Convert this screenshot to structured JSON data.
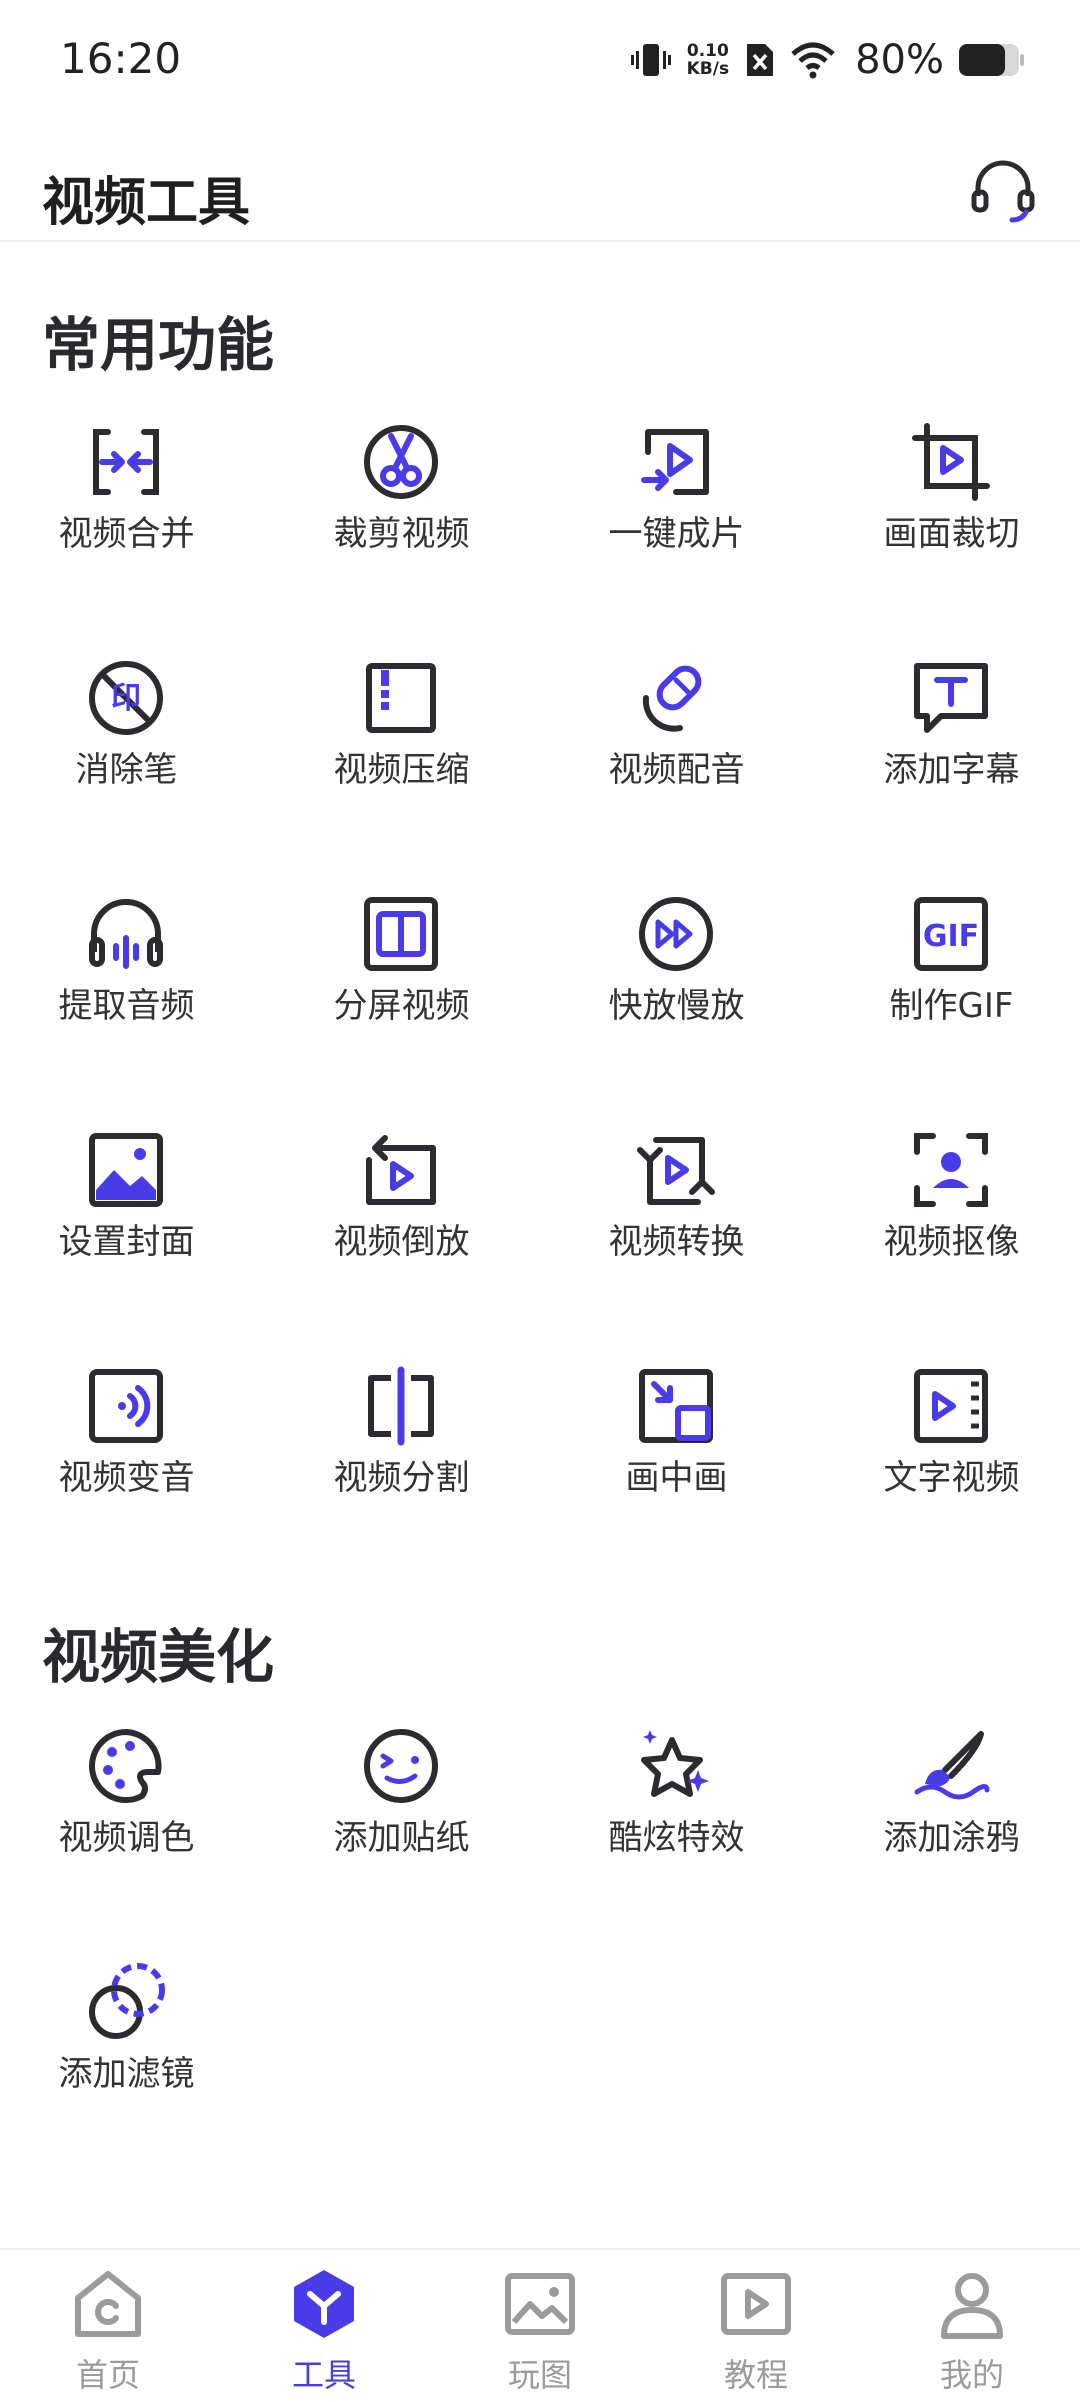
{
  "status_bar": {
    "time": "16:20",
    "net_speed_value": "0.10",
    "net_speed_unit": "KB/s",
    "battery": "80%",
    "icons": [
      "vibrate-icon",
      "no-sim-icon",
      "wifi-icon",
      "battery-icon"
    ]
  },
  "header": {
    "title": "视频工具",
    "support_icon": "headset-icon"
  },
  "sections": [
    {
      "title": "常用功能",
      "items": [
        {
          "label": "视频合并",
          "icon": "merge-icon"
        },
        {
          "label": "裁剪视频",
          "icon": "scissors-icon"
        },
        {
          "label": "一键成片",
          "icon": "one-click-video-icon"
        },
        {
          "label": "画面裁切",
          "icon": "crop-icon"
        },
        {
          "label": "消除笔",
          "icon": "remove-watermark-icon"
        },
        {
          "label": "视频压缩",
          "icon": "compress-icon"
        },
        {
          "label": "视频配音",
          "icon": "dubbing-icon"
        },
        {
          "label": "添加字幕",
          "icon": "subtitle-icon"
        },
        {
          "label": "提取音频",
          "icon": "headphones-icon"
        },
        {
          "label": "分屏视频",
          "icon": "split-screen-icon"
        },
        {
          "label": "快放慢放",
          "icon": "speed-icon"
        },
        {
          "label": "制作GIF",
          "icon": "gif-icon"
        },
        {
          "label": "设置封面",
          "icon": "cover-image-icon"
        },
        {
          "label": "视频倒放",
          "icon": "reverse-icon"
        },
        {
          "label": "视频转换",
          "icon": "convert-icon"
        },
        {
          "label": "视频抠像",
          "icon": "portrait-cutout-icon"
        },
        {
          "label": "视频变音",
          "icon": "voice-change-icon"
        },
        {
          "label": "视频分割",
          "icon": "video-split-icon"
        },
        {
          "label": "画中画",
          "icon": "picture-in-picture-icon"
        },
        {
          "label": "文字视频",
          "icon": "text-video-icon"
        }
      ]
    },
    {
      "title": "视频美化",
      "items": [
        {
          "label": "视频调色",
          "icon": "palette-icon"
        },
        {
          "label": "添加贴纸",
          "icon": "sticker-icon"
        },
        {
          "label": "酷炫特效",
          "icon": "effects-star-icon"
        },
        {
          "label": "添加涂鸦",
          "icon": "brush-icon"
        },
        {
          "label": "添加滤镜",
          "icon": "filter-icon"
        }
      ]
    }
  ],
  "bottom_nav": [
    {
      "label": "首页",
      "icon": "home-icon",
      "active": false
    },
    {
      "label": "工具",
      "icon": "tools-icon",
      "active": true
    },
    {
      "label": "玩图",
      "icon": "image-icon",
      "active": false
    },
    {
      "label": "教程",
      "icon": "tutorial-icon",
      "active": false
    },
    {
      "label": "我的",
      "icon": "profile-icon",
      "active": false
    }
  ],
  "colors": {
    "accent": "#4a3be8",
    "icon_dark": "#2c2c30",
    "inactive_text": "#9b9b9b"
  }
}
